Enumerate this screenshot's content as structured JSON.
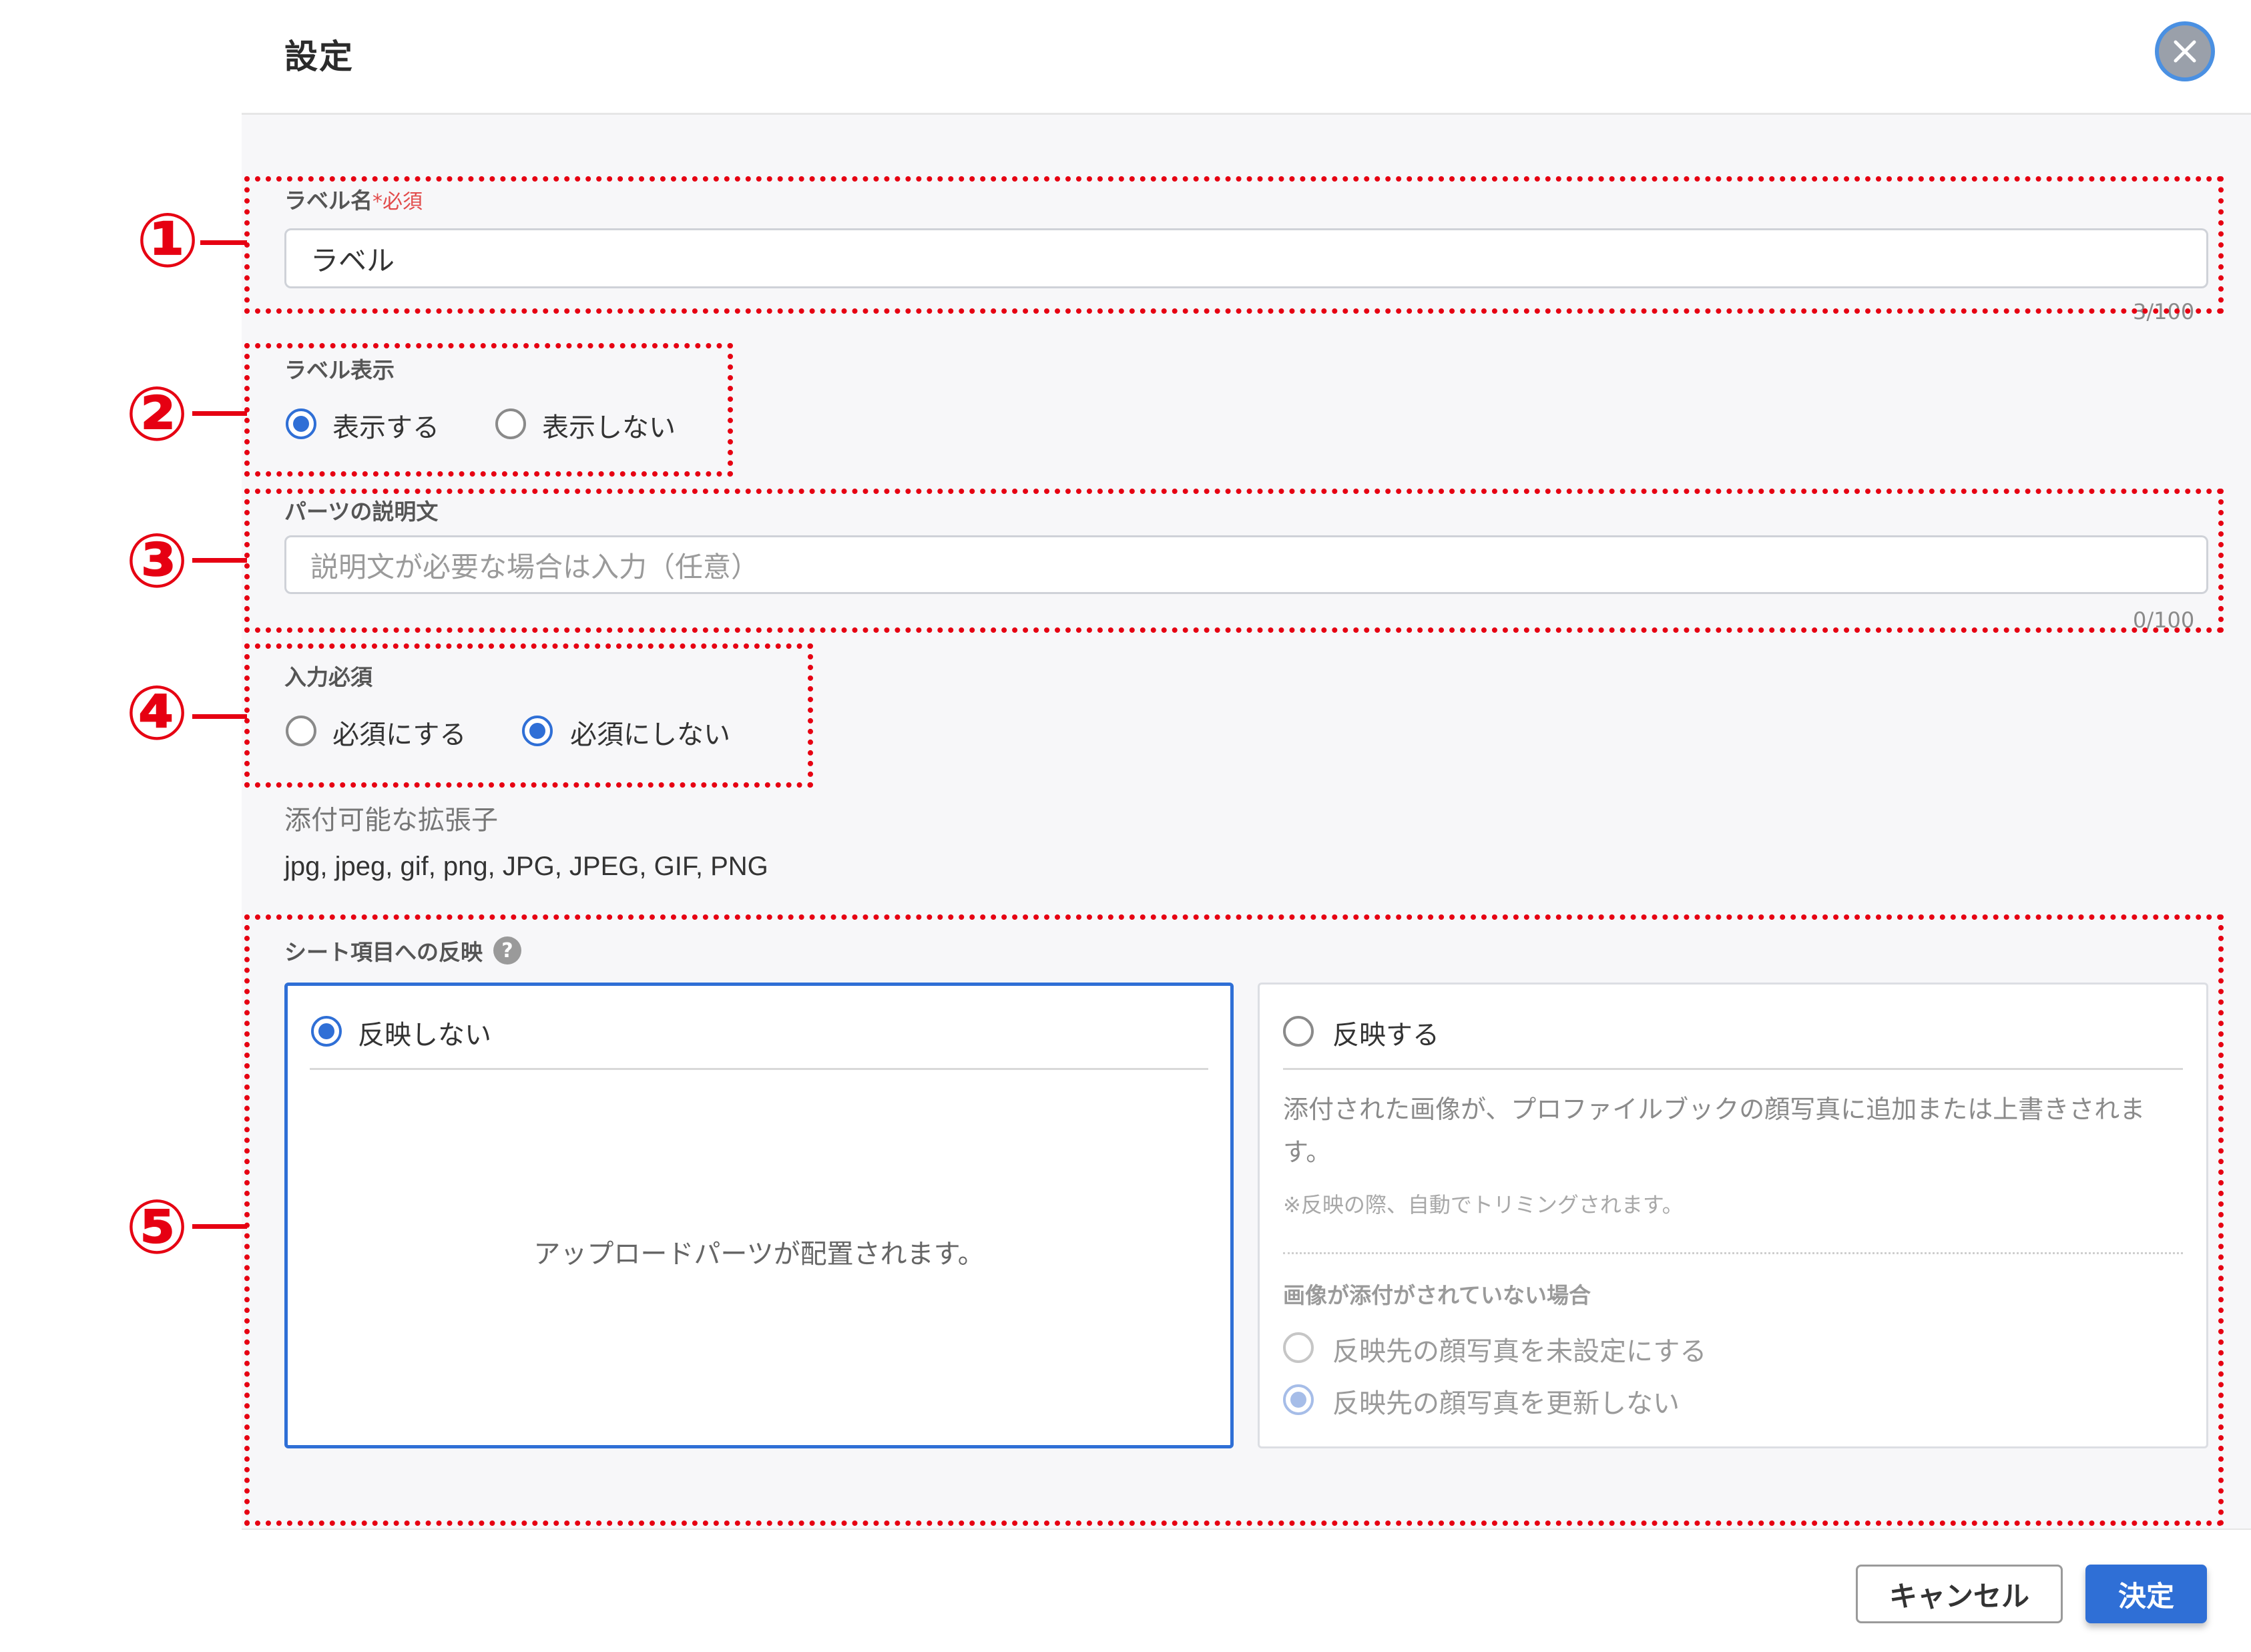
{
  "header": {
    "title": "設定"
  },
  "fields": {
    "label_name": {
      "label": "ラベル名",
      "required_mark": "*必須",
      "value": "ラベル",
      "counter": "3/100"
    },
    "label_display": {
      "label": "ラベル表示",
      "options": [
        "表示する",
        "表示しない"
      ],
      "selected": "表示する"
    },
    "description": {
      "label": "パーツの説明文",
      "placeholder": "説明文が必要な場合は入力（任意）",
      "counter": "0/100"
    },
    "input_required": {
      "label": "入力必須",
      "options": [
        "必須にする",
        "必須にしない"
      ],
      "selected": "必須にしない"
    },
    "extensions": {
      "label": "添付可能な拡張子",
      "value": "jpg, jpeg, gif, png, JPG, JPEG, GIF, PNG"
    },
    "sheet_reflect": {
      "label": "シート項目への反映",
      "help_icon": "?",
      "card_no_reflect": {
        "option": "反映しない",
        "body": "アップロードパーツが配置されます。"
      },
      "card_reflect": {
        "option": "反映する",
        "description": "添付された画像が、プロファイルブックの顔写真に追加または上書きされます。",
        "note": "※反映の際、自動でトリミングされます。",
        "sub_label": "画像が添付がされていない場合",
        "sub_options": [
          "反映先の顔写真を未設定にする",
          "反映先の顔写真を更新しない"
        ],
        "sub_selected": "反映先の顔写真を更新しない"
      },
      "selected": "反映しない"
    }
  },
  "footer": {
    "cancel_label": "キャンセル",
    "ok_label": "決定"
  },
  "annotations": [
    "①",
    "②",
    "③",
    "④",
    "⑤"
  ],
  "colors": {
    "annotation": "#e60012",
    "accent": "#2f6fd6"
  }
}
